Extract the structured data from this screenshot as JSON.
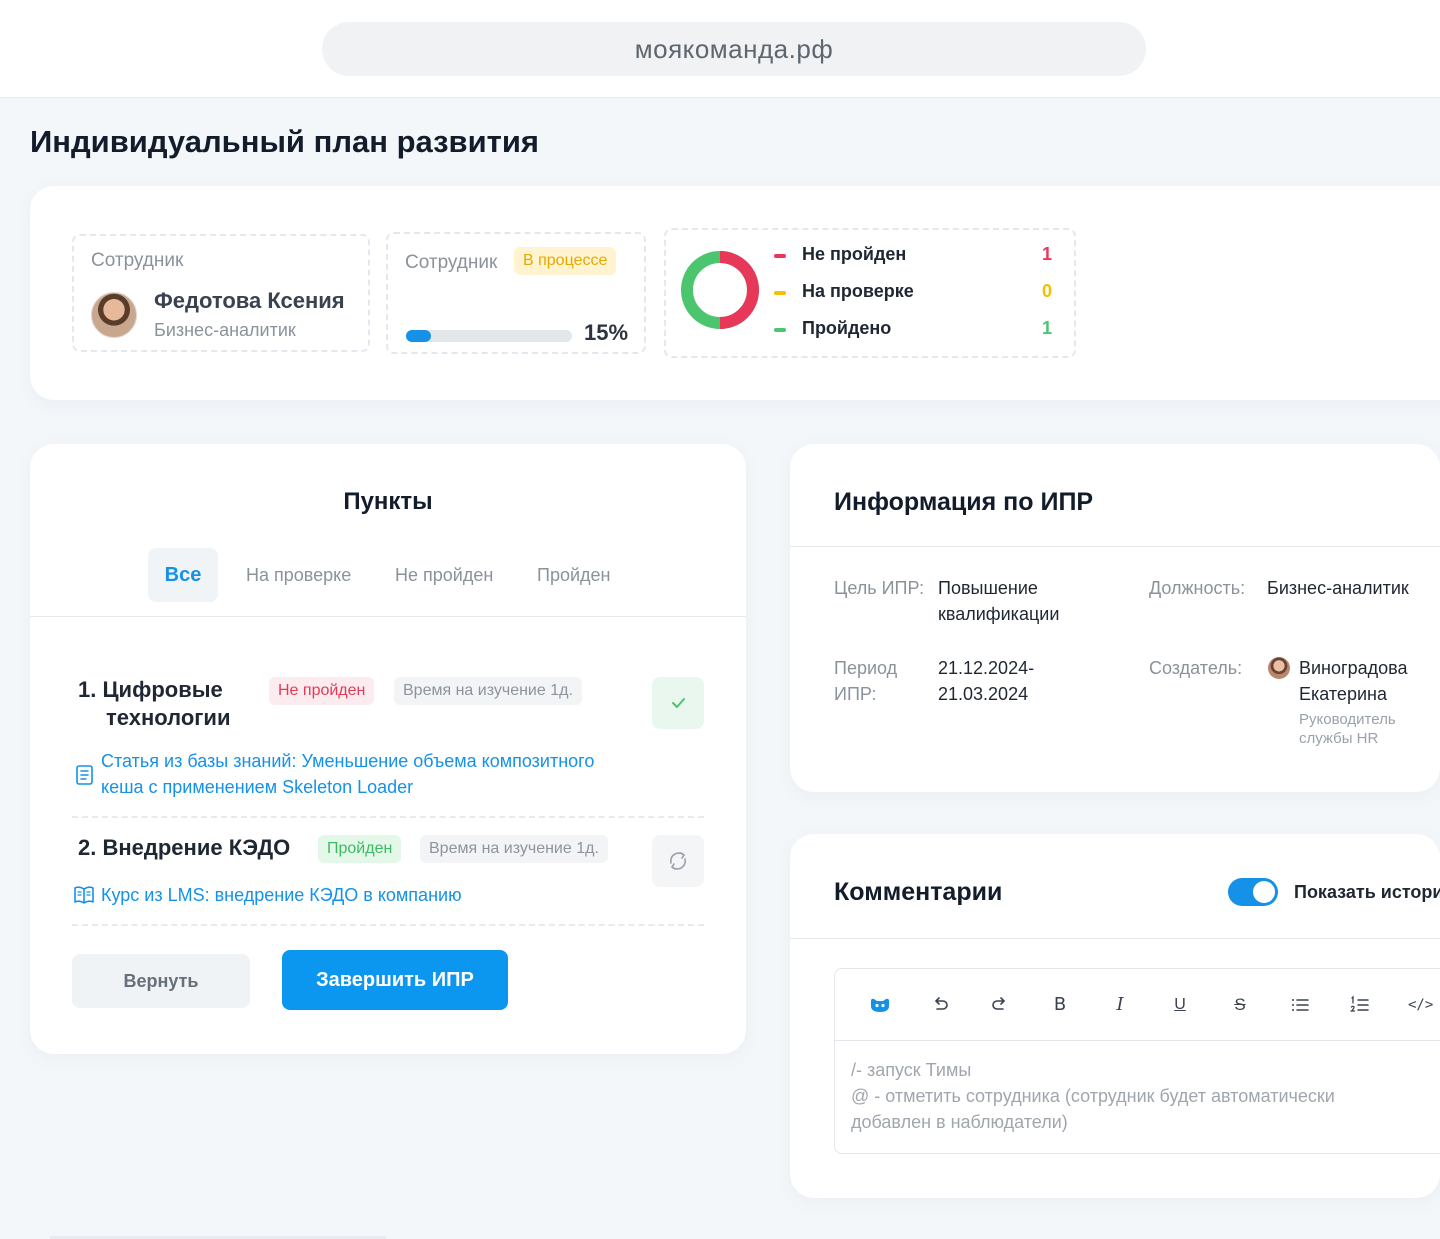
{
  "browser": {
    "url": "моякоманда.рф"
  },
  "page": {
    "title": "Индивидуальный план развития"
  },
  "summary": {
    "employee": {
      "label": "Сотрудник",
      "name": "Федотова Ксения",
      "role": "Бизнес-аналитик"
    },
    "progress": {
      "label": "Сотрудник",
      "status": "В процессе",
      "percent_text": "15%",
      "fraction": 0.15
    },
    "stats": [
      {
        "label": "Не пройден",
        "value": "1",
        "color": "#e8385a"
      },
      {
        "label": "На проверке",
        "value": "0",
        "color": "#f5c000"
      },
      {
        "label": "Пройдено",
        "value": "1",
        "color": "#4cc56f"
      }
    ]
  },
  "items": {
    "title": "Пункты",
    "tabs": [
      "Все",
      "На проверке",
      "Не пройден",
      "Пройден"
    ],
    "active_tab": "Все",
    "list": [
      {
        "number": "1.",
        "title_line1": "Цифровые",
        "title_line2": "технологии",
        "status": "Не пройден",
        "time": "Время на изучение 1д.",
        "action_icon": "check-icon",
        "link_icon": "article-icon",
        "link_line1": "Статья из базы знаний: Уменьшение объема композитного",
        "link_line2": "кеша с применением Skeleton Loader"
      },
      {
        "number": "2.",
        "title_line1": "Внедрение КЭДО",
        "status": "Пройден",
        "time": "Время на изучение 1д.",
        "action_icon": "refresh-icon",
        "link_icon": "book-icon",
        "link_line1": "Курс из LMS: внедрение КЭДО в компанию"
      }
    ],
    "return_label": "Вернуть",
    "finish_label": "Завершить ИПР"
  },
  "info": {
    "title": "Информация по ИПР",
    "goal_label": "Цель ИПР:",
    "goal_line1": "Повышение",
    "goal_line2": "квалификации",
    "position_label": "Должность:",
    "position_value": "Бизнес-аналитик",
    "period_label_line1": "Период",
    "period_label_line2": "ИПР:",
    "period_line1": "21.12.2024-",
    "period_line2": "21.03.2024",
    "creator_label": "Создатель:",
    "creator_line1": "Виноградова",
    "creator_line2": "Екатерина",
    "creator_role_line1": "Руководитель",
    "creator_role_line2": "службы HR"
  },
  "comments": {
    "title": "Комментарии",
    "toggle_label": "Показать истори",
    "toggle_on": true,
    "toolbar": [
      "assistant-icon",
      "undo-icon",
      "redo-icon",
      "bold-icon",
      "italic-icon",
      "underline-icon",
      "strikethrough-icon",
      "bullet-list-icon",
      "numbered-list-icon",
      "code-icon"
    ],
    "placeholder_line1": "/- запуск Тимы",
    "placeholder_line2": "@ - отметить сотрудника (сотрудник будет автоматически",
    "placeholder_line3": "добавлен в наблюдатели)"
  }
}
